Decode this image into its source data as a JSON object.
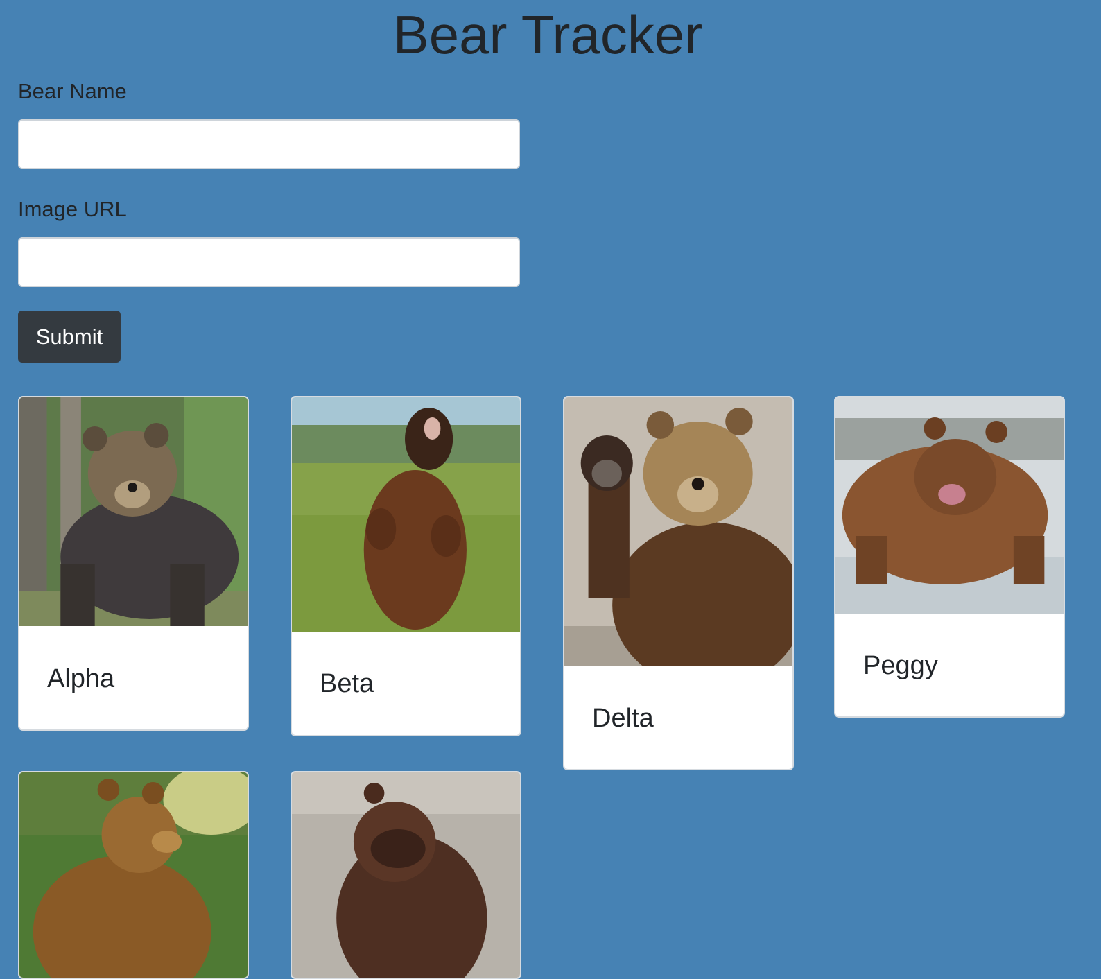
{
  "header": {
    "title": "Bear Tracker"
  },
  "form": {
    "name_label": "Bear Name",
    "name_value": "",
    "url_label": "Image URL",
    "url_value": "",
    "submit_label": "Submit"
  },
  "bears": [
    {
      "name": "Alpha",
      "image": "brown-bear-in-forest-photo"
    },
    {
      "name": "Beta",
      "image": "roaring-bear-in-meadow-photo"
    },
    {
      "name": "Delta",
      "image": "waving-bear-photo"
    },
    {
      "name": "Peggy",
      "image": "bear-in-water-photo"
    },
    {
      "name": "",
      "image": "sitting-bear-in-grass-photo"
    },
    {
      "name": "",
      "image": "bear-covering-face-photo"
    }
  ],
  "colors": {
    "background": "#4682b4",
    "button": "#343a40",
    "text": "#212529"
  }
}
